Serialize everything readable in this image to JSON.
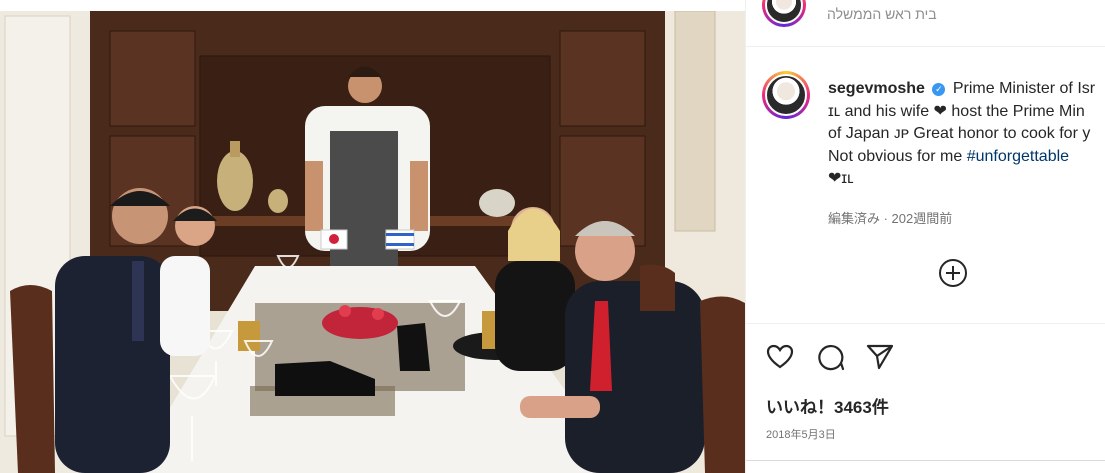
{
  "header": {
    "location": "בית ראש הממשלה"
  },
  "post": {
    "username": "segevmoshe",
    "caption_line1": "Prime Minister of Isr",
    "caption_line2": "ɪʟ and his wife ❤ host the Prime Min",
    "caption_line3": "of Japan ᴊᴘ Great honor to cook for y",
    "caption_line4_text": "Not obvious for me ",
    "hashtag": "#unforgettable",
    "caption_line5": "❤ɪʟ",
    "edited": "編集済み · 202週間前",
    "likes": "いいね！3463件",
    "date": "2018年5月3日"
  },
  "colors": {
    "verified": "#3897f0",
    "hashtag": "#00376b",
    "muted": "#737373"
  },
  "icons": {
    "verified": "verified-badge-icon",
    "more": "circle-plus-icon",
    "like": "heart-icon",
    "comment": "comment-bubble-icon",
    "share": "paper-plane-icon"
  }
}
